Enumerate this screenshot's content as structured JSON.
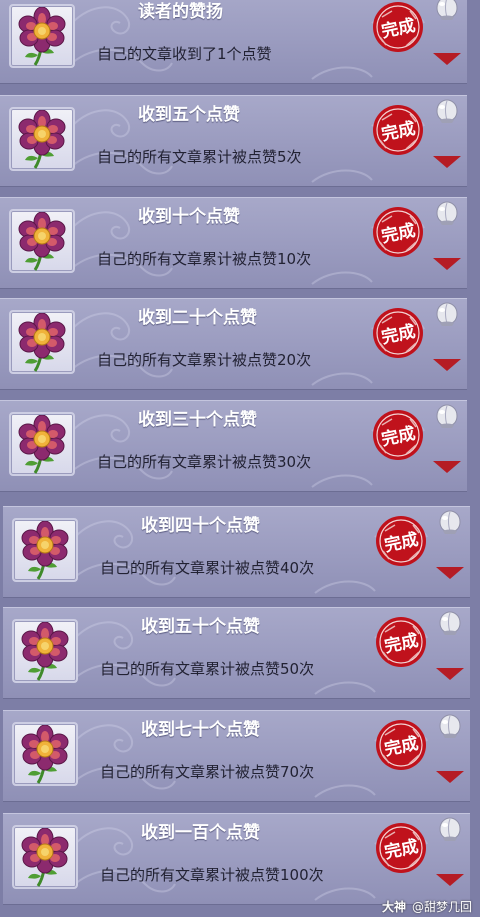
{
  "achievements": [
    {
      "title": "读者的赞扬",
      "desc": "自己的文章收到了1个点赞",
      "stamp_text": "完成"
    },
    {
      "title": "收到五个点赞",
      "desc": "自己的所有文章累计被点赞5次",
      "stamp_text": "完成"
    },
    {
      "title": "收到十个点赞",
      "desc": "自己的所有文章累计被点赞10次",
      "stamp_text": "完成"
    },
    {
      "title": "收到二十个点赞",
      "desc": "自己的所有文章累计被点赞20次",
      "stamp_text": "完成"
    },
    {
      "title": "收到三十个点赞",
      "desc": "自己的所有文章累计被点赞30次",
      "stamp_text": "完成"
    },
    {
      "title": "收到四十个点赞",
      "desc": "自己的所有文章累计被点赞40次",
      "stamp_text": "完成"
    },
    {
      "title": "收到五十个点赞",
      "desc": "自己的所有文章累计被点赞50次",
      "stamp_text": "完成"
    },
    {
      "title": "收到七十个点赞",
      "desc": "自己的所有文章累计被点赞70次",
      "stamp_text": "完成"
    },
    {
      "title": "收到一百个点赞",
      "desc": "自己的所有文章累计被点赞100次",
      "stamp_text": "完成"
    }
  ],
  "icons": {
    "reward": "flower-icon",
    "status": "completed-stamp-icon",
    "extra": "peach-icon",
    "expand": "triangle-down-icon"
  },
  "colors": {
    "stamp": "#c0121c",
    "arrow": "#b51c24",
    "card": "#9a9bbf",
    "title": "#ffffff"
  },
  "watermark": {
    "brand": "大神",
    "handle": "@甜梦几回"
  }
}
